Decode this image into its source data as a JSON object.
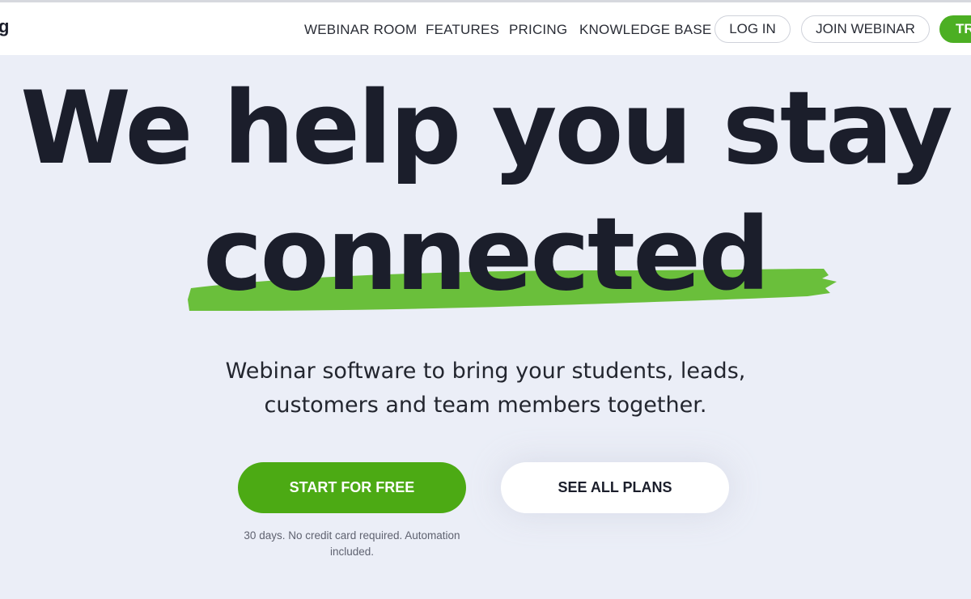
{
  "header": {
    "logo_fragment": "g",
    "nav": [
      {
        "label": "WEBINAR ROOM"
      },
      {
        "label": "FEATURES"
      },
      {
        "label": "PRICING"
      },
      {
        "label": "KNOWLEDGE BASE"
      }
    ],
    "login_label": "LOG IN",
    "join_webinar_label": "JOIN WEBINAR",
    "trial_label_fragment": "TR"
  },
  "hero": {
    "headline_line1": "We help you stay",
    "headline_line2": "connected",
    "subtitle_line1": "Webinar software to bring your students, leads,",
    "subtitle_line2": "customers and team members together.",
    "primary_cta": "START FOR FREE",
    "secondary_cta": "SEE ALL PLANS",
    "note": "30 days. No credit card required. Automation included."
  },
  "colors": {
    "accent_green": "#4caa14",
    "swoosh_green": "#6abf3b",
    "background": "#ebeef7",
    "text_dark": "#1b1e2b"
  }
}
